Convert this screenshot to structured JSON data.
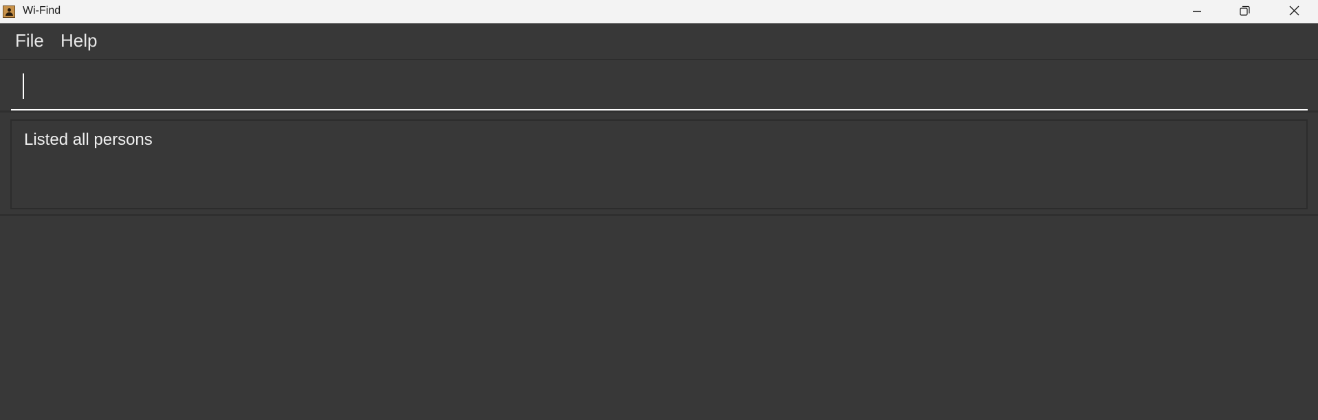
{
  "window": {
    "title": "Wi-Find",
    "icon": "person-contact-icon"
  },
  "titlebar_buttons": {
    "minimize_icon": "minimize-icon",
    "maximize_icon": "restore-icon",
    "close_icon": "close-icon"
  },
  "menu": {
    "file_label": "File",
    "help_label": "Help"
  },
  "command": {
    "value": "",
    "placeholder": ""
  },
  "result": {
    "message": "Listed all persons"
  },
  "colors": {
    "background": "#383838",
    "titlebar": "#f3f3f3",
    "text": "#f0f0f0",
    "input_underline": "#ffffff"
  }
}
